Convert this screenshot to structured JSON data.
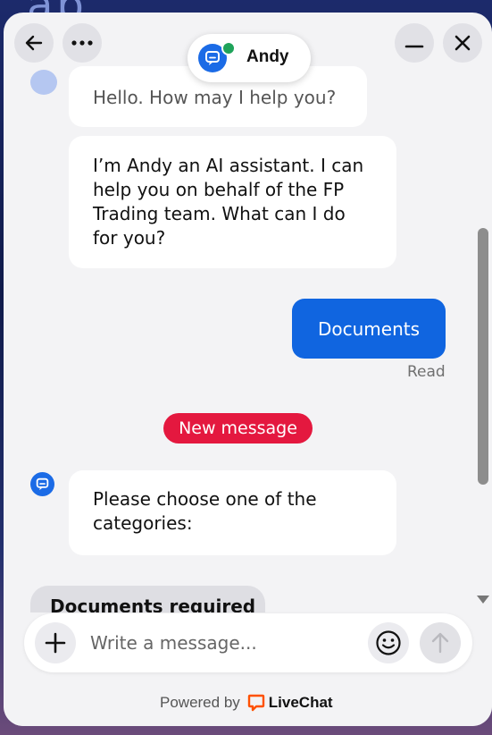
{
  "background": {
    "text": "ab"
  },
  "header": {
    "agent_name": "Andy",
    "status_color": "#1fa35a",
    "icons": [
      "back-arrow-icon",
      "more-dots-icon",
      "minimize-icon",
      "close-icon"
    ]
  },
  "messages": {
    "m1": "Hello. How may I help you?",
    "m2": "I’m Andy an AI assistant. I can help you on behalf of the FP Trading team. What can I do for you?",
    "user": "Documents",
    "read_status": "Read",
    "new_message_label": "New message",
    "m3": "Please choose one of the categories:",
    "category_chip": "Documents required"
  },
  "composer": {
    "placeholder": "Write a message...",
    "powered_by": "Powered by",
    "brand": "LiveChat"
  },
  "colors": {
    "accent": "#1065e0",
    "new_message": "#e4183f",
    "brand_orange": "#ff5100"
  }
}
